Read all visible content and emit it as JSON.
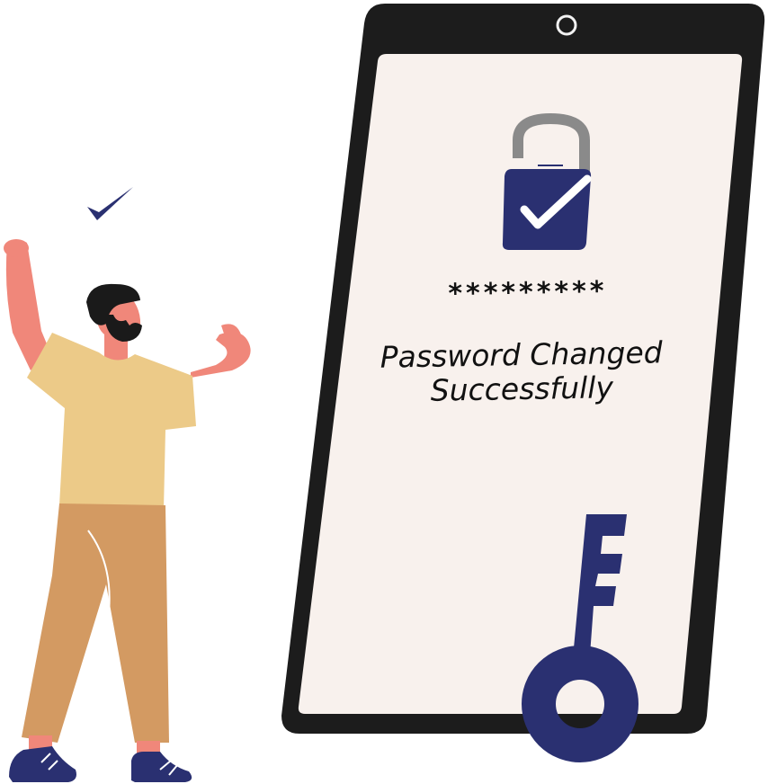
{
  "screen": {
    "password_mask": "*********",
    "message_line1": "Password Changed",
    "message_line2": "Successfully"
  },
  "icons": {
    "lock": "unlocked-padlock-checkmark-icon",
    "key": "key-icon",
    "check": "checkmark-icon",
    "camera": "front-camera-icon"
  },
  "colors": {
    "phone_frame": "#1c1c1c",
    "screen_bg": "#f8f1ed",
    "accent_navy": "#2a3071",
    "shackle_gray": "#8a8a8a",
    "skin": "#f0877a",
    "shirt": "#ecca88",
    "pants": "#d39a62",
    "hair": "#1a1a1a"
  }
}
